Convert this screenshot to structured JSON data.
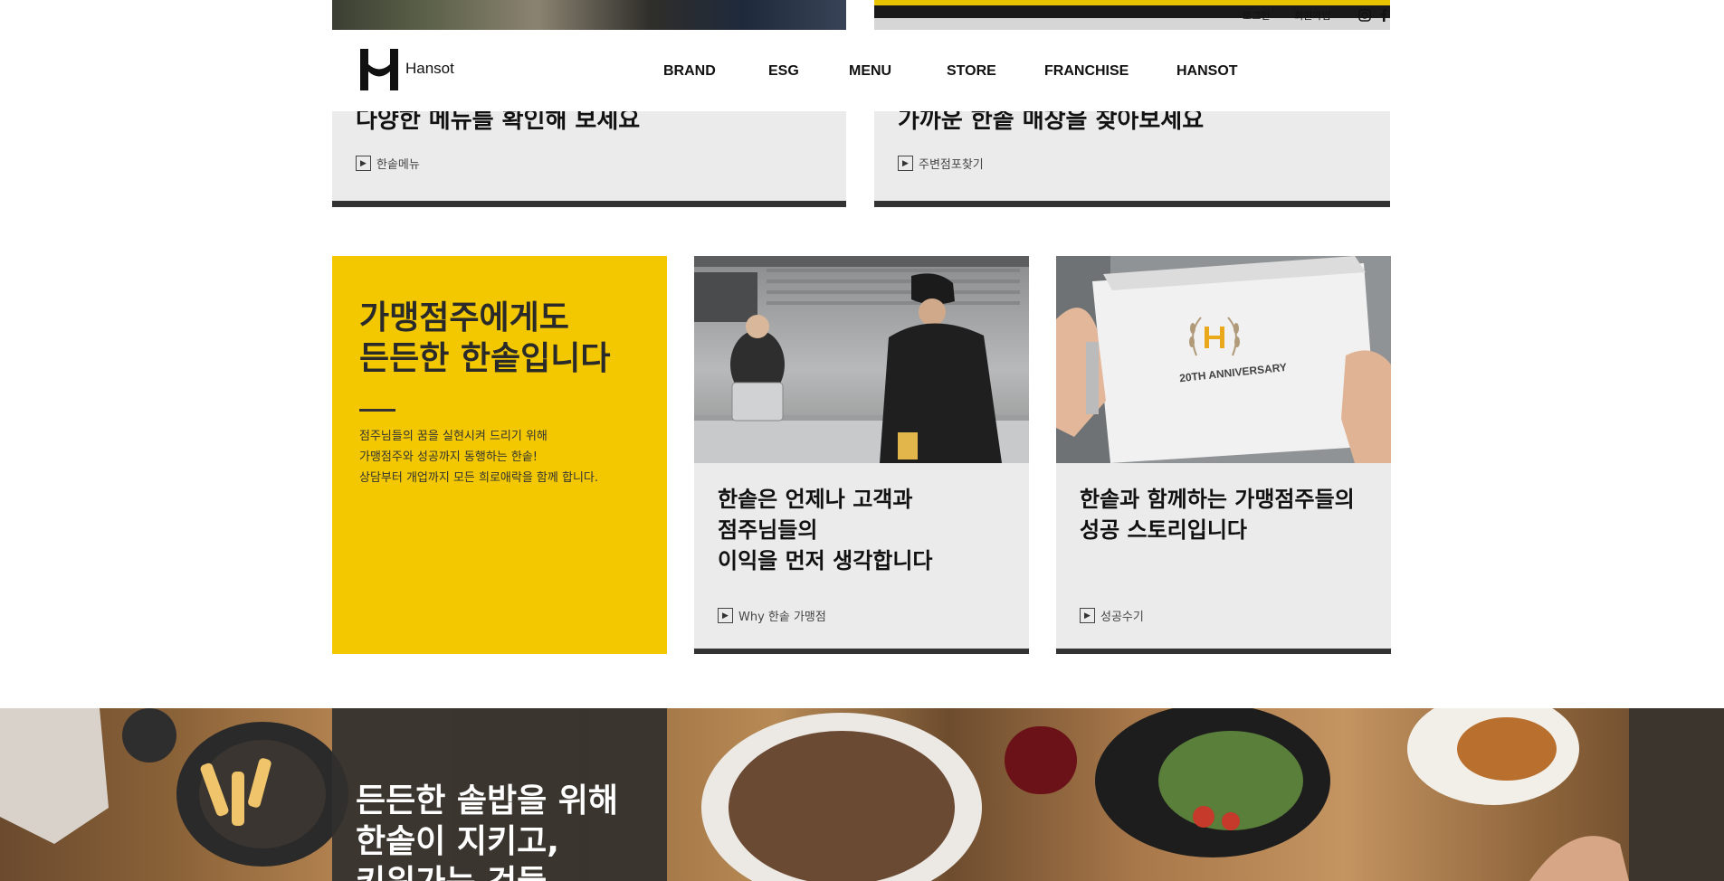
{
  "utility": {
    "login": "로그인",
    "join": "회원가입"
  },
  "header": {
    "logo_text": "Hansot",
    "nav": [
      "BRAND",
      "ESG",
      "MENU",
      "STORE",
      "FRANCHISE",
      "HANSOT"
    ]
  },
  "top_cards": [
    {
      "title": "다양한 메뉴를 확인해 보세요",
      "link": "한솥메뉴"
    },
    {
      "title": "가까운 한솥 매장을 찾아보세요",
      "link": "주변점포찾기"
    }
  ],
  "franchise": {
    "heading_line1": "가맹점주에게도",
    "heading_line2": "든든한 한솥입니다",
    "desc_line1": "점주님들의 꿈을 실현시켜 드리기 위해",
    "desc_line2": "가맹점주와 성공까지 동행하는 한솥!",
    "desc_line3": "상담부터 개업까지 모든 희로애락을 함께 합니다.",
    "card1": {
      "line1": "한솥은 언제나 고객과",
      "line2": "점주님들의",
      "line3": "이익을 먼저 생각합니다",
      "link": "Why 한솥 가맹점"
    },
    "card2": {
      "line1": "한솥과 함께하는 가맹점주들의",
      "line2": "성공 스토리입니다",
      "link": "성공수기",
      "emblem_text": "20TH ANNIVERSARY"
    }
  },
  "banner": {
    "line1": "든든한 솥밥을 위해",
    "line2": "한솥이 지키고,",
    "line3": "키워가는 것들"
  }
}
